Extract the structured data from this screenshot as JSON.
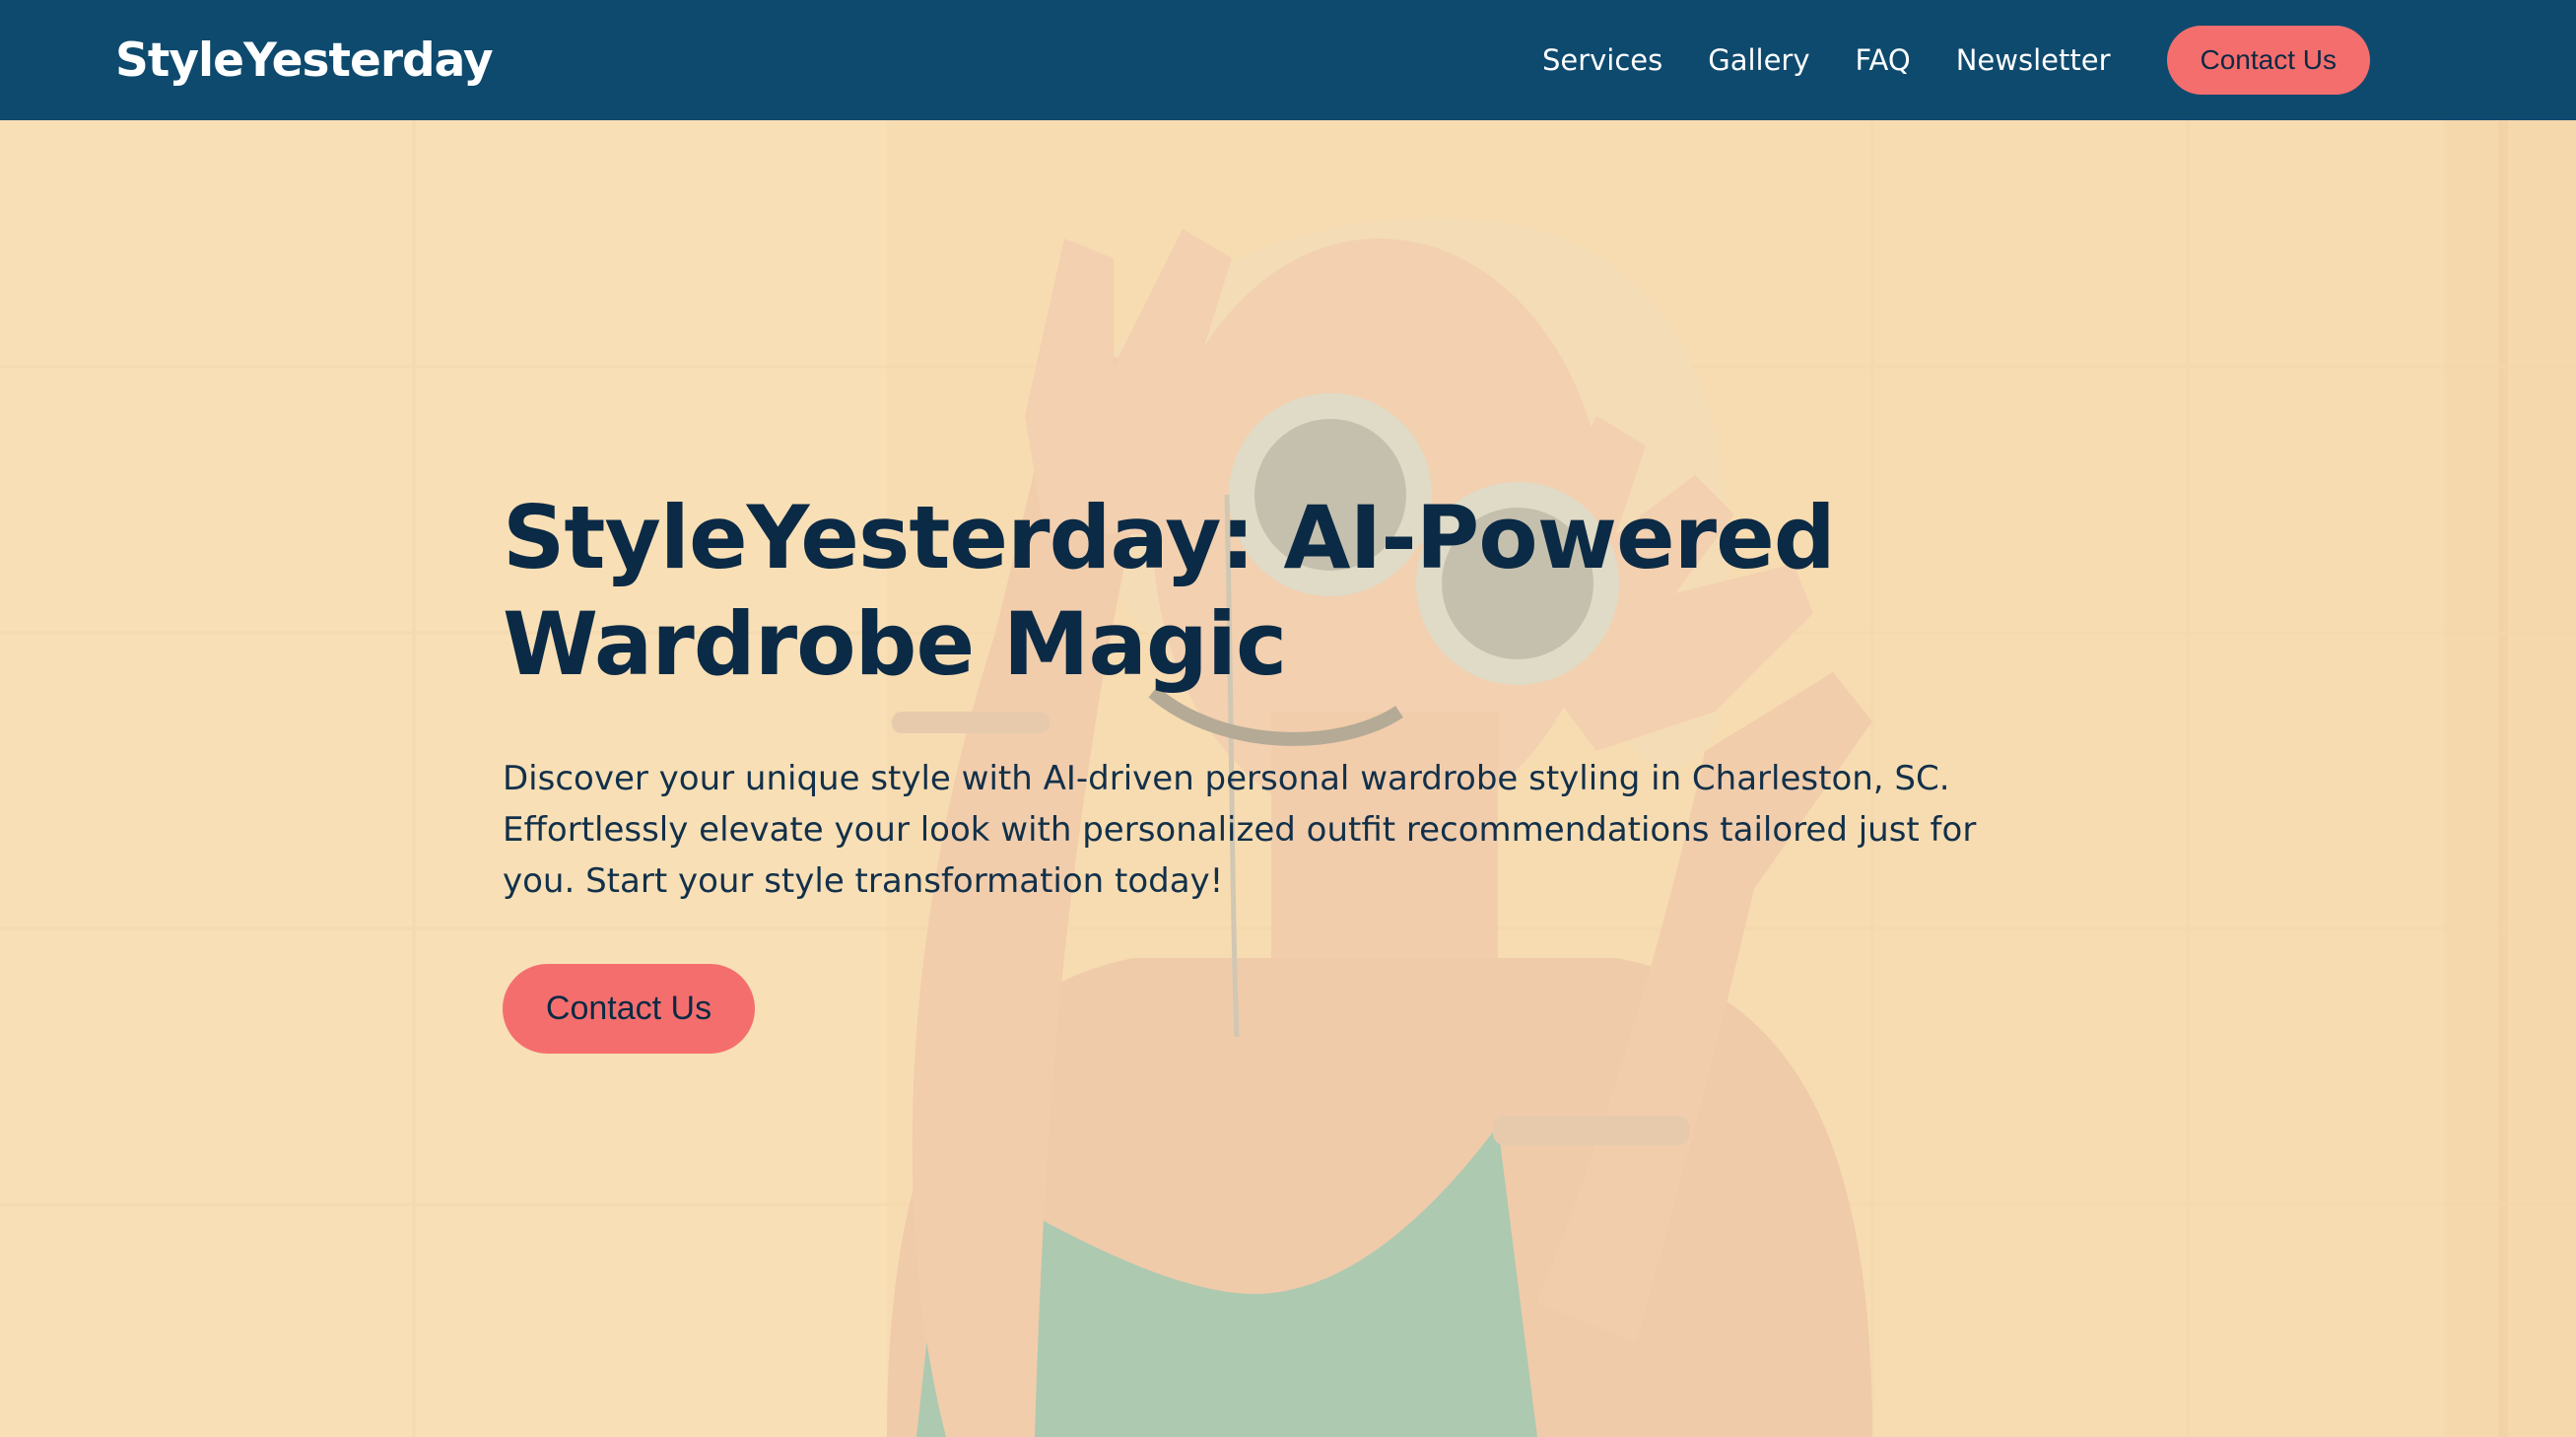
{
  "nav": {
    "brand": "StyleYesterday",
    "links": [
      "Services",
      "Gallery",
      "FAQ",
      "Newsletter"
    ],
    "cta_label": "Contact Us"
  },
  "hero": {
    "title": "StyleYesterday: AI-Powered Wardrobe Magic",
    "description": "Discover your unique style with AI-driven personal wardrobe styling in Charleston, SC. Effortlessly elevate your look with personalized outfit recommendations tailored just for you. Start your style transformation today!",
    "cta_label": "Contact Us"
  },
  "colors": {
    "nav_background": "#0e4a6e",
    "accent": "#f56e6e",
    "heading": "#0b2a45"
  }
}
